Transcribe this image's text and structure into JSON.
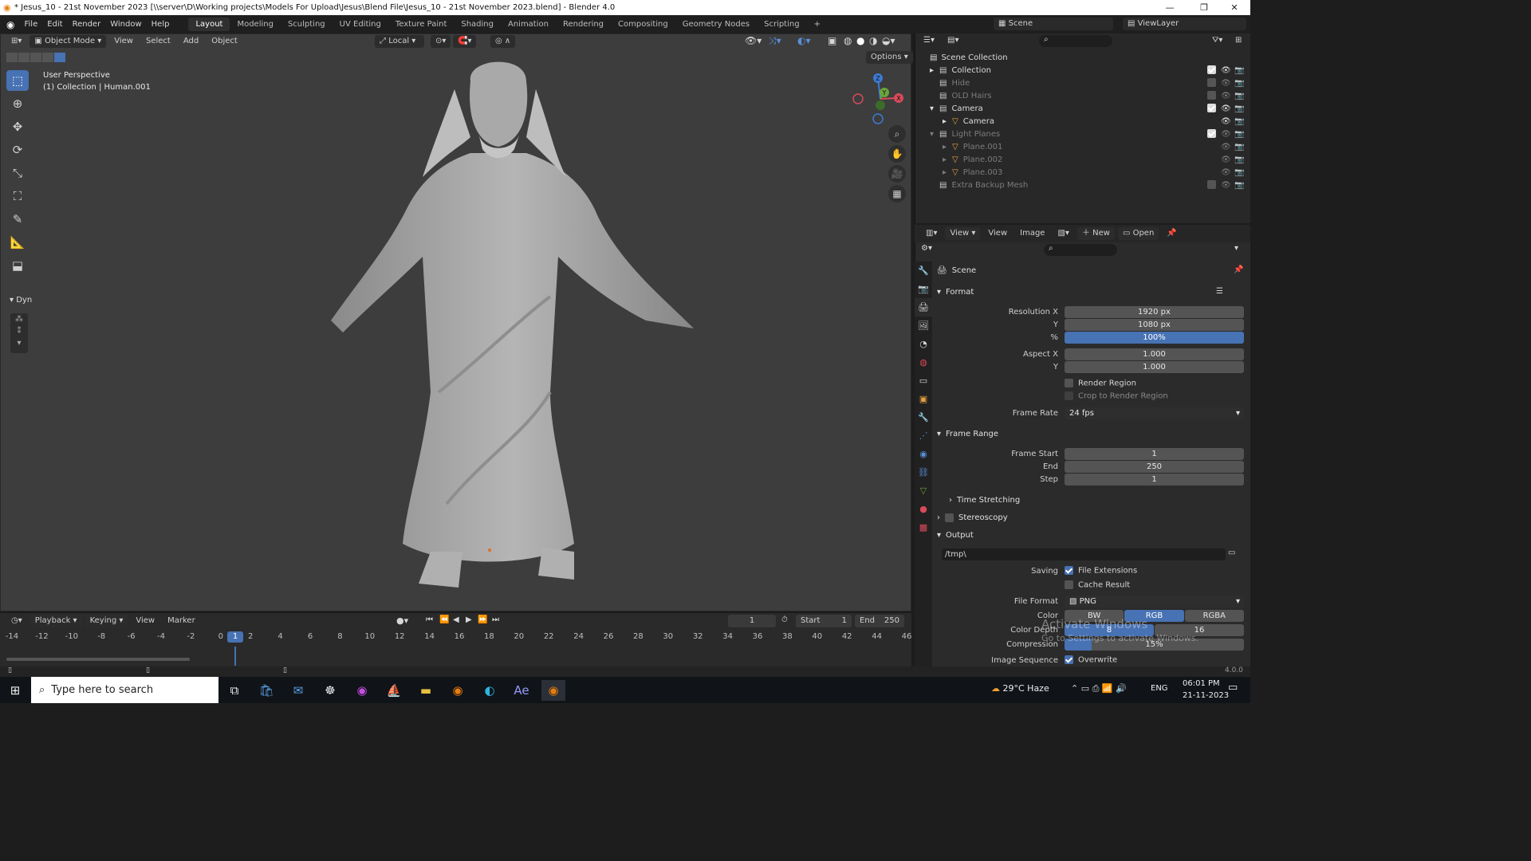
{
  "window": {
    "title": "* Jesus_10 - 21st November 2023 [\\\\server\\D\\Working projects\\Models For Upload\\Jesus\\Blend File\\Jesus_10 - 21st November 2023.blend] - Blender 4.0",
    "minimize": "—",
    "maximize": "❐",
    "close": "✕"
  },
  "menu": {
    "items": [
      "File",
      "Edit",
      "Render",
      "Window",
      "Help"
    ],
    "workspaces": [
      "Layout",
      "Modeling",
      "Sculpting",
      "UV Editing",
      "Texture Paint",
      "Shading",
      "Animation",
      "Rendering",
      "Compositing",
      "Geometry Nodes",
      "Scripting"
    ],
    "active_workspace": "Layout",
    "add_workspace": "+",
    "scene_label": "Scene",
    "viewlayer_label": "ViewLayer"
  },
  "viewport": {
    "mode": "Object Mode",
    "menus": [
      "View",
      "Select",
      "Add",
      "Object"
    ],
    "transform_orientation": "Local",
    "options": "Options",
    "perspective_label": "User Perspective",
    "collection_label": "(1) Collection | Human.001",
    "dyn_label": "Dyn",
    "axis_x": "X",
    "axis_y": "Y",
    "axis_z": "Z"
  },
  "timeline": {
    "menus": [
      "Playback",
      "Keying",
      "View",
      "Marker"
    ],
    "current_frame": "1",
    "start_label": "Start",
    "start": "1",
    "end_label": "End",
    "end": "250",
    "ticks": [
      "-14",
      "-12",
      "-10",
      "-8",
      "-6",
      "-4",
      "-2",
      "0",
      "2",
      "4",
      "6",
      "8",
      "10",
      "12",
      "14",
      "16",
      "18",
      "20",
      "22",
      "24",
      "26",
      "28",
      "30",
      "32",
      "34",
      "36",
      "38",
      "40",
      "42",
      "44",
      "46"
    ],
    "playhead": "1"
  },
  "outliner": {
    "root": "Scene Collection",
    "rows": [
      {
        "label": "Collection",
        "dim": false,
        "indent": 1,
        "expand": "▸",
        "checked": true
      },
      {
        "label": "Hide",
        "dim": true,
        "indent": 1,
        "expand": "",
        "checked": false
      },
      {
        "label": "OLD Hairs",
        "dim": true,
        "indent": 1,
        "expand": "",
        "checked": false
      },
      {
        "label": "Camera",
        "dim": false,
        "indent": 1,
        "expand": "▾",
        "checked": true
      },
      {
        "label": "Camera",
        "dim": false,
        "indent": 2,
        "expand": "▸",
        "checked": null
      },
      {
        "label": "Light Planes",
        "dim": true,
        "indent": 1,
        "expand": "▾",
        "checked": true
      },
      {
        "label": "Plane.001",
        "dim": true,
        "indent": 2,
        "expand": "▸",
        "checked": null
      },
      {
        "label": "Plane.002",
        "dim": true,
        "indent": 2,
        "expand": "▸",
        "checked": null
      },
      {
        "label": "Plane.003",
        "dim": true,
        "indent": 2,
        "expand": "▸",
        "checked": null
      },
      {
        "label": "Extra Backup Mesh",
        "dim": true,
        "indent": 1,
        "expand": "",
        "checked": false
      }
    ]
  },
  "image_editor_header": {
    "view": "View",
    "view2": "View",
    "image": "Image",
    "new": "New",
    "open": "Open"
  },
  "properties": {
    "context": "Scene",
    "format": {
      "title": "Format",
      "resolution_x_label": "Resolution X",
      "resolution_x": "1920 px",
      "y_label": "Y",
      "resolution_y": "1080 px",
      "percent_label": "%",
      "percent": "100%",
      "aspect_x_label": "Aspect X",
      "aspect_x": "1.000",
      "aspect_y_label": "Y",
      "aspect_y": "1.000",
      "render_region": "Render Region",
      "crop_region": "Crop to Render Region",
      "frame_rate_label": "Frame Rate",
      "frame_rate": "24 fps"
    },
    "frame_range": {
      "title": "Frame Range",
      "start_label": "Frame Start",
      "start": "1",
      "end_label": "End",
      "end": "250",
      "step_label": "Step",
      "step": "1"
    },
    "time_stretching": "Time Stretching",
    "stereoscopy": "Stereoscopy",
    "output": {
      "title": "Output",
      "path": "/tmp\\",
      "saving_label": "Saving",
      "file_extensions": "File Extensions",
      "cache_result": "Cache Result",
      "file_format_label": "File Format",
      "file_format": "PNG",
      "color_label": "Color",
      "color_options": [
        "BW",
        "RGB",
        "RGBA"
      ],
      "color_selected": "RGB",
      "color_depth_label": "Color Depth",
      "color_depth_options": [
        "8",
        "16"
      ],
      "compression_label": "Compression",
      "compression": "15%",
      "image_sequence_label": "Image Sequence",
      "overwrite": "Overwrite"
    },
    "watermark_line1": "Activate Windows",
    "watermark_line2": "Go to Settings to activate Windows."
  },
  "statusbar": {
    "version": "4.0.0"
  },
  "taskbar": {
    "search_placeholder": "Type here to search",
    "weather": "29°C  Haze",
    "lang": "ENG",
    "time": "06:01 PM",
    "date": "21-11-2023"
  }
}
